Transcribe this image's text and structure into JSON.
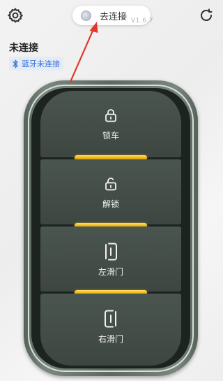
{
  "header": {
    "connect_label": "去连接",
    "version": "V1.6.7"
  },
  "status": {
    "title": "未连接",
    "bluetooth_label": "蓝牙未连接"
  },
  "remote": {
    "buttons": [
      {
        "label": "锁车",
        "icon": "lock-icon"
      },
      {
        "label": "解锁",
        "icon": "unlock-icon"
      },
      {
        "label": "左滑门",
        "icon": "left-sliding-door-icon"
      },
      {
        "label": "右滑门",
        "icon": "right-sliding-door-icon"
      }
    ]
  },
  "colors": {
    "accent_blue": "#2f6fd6",
    "annotation_red": "#e03a2f",
    "remote_body": "#4b5550",
    "divider_gold": "#f1b514"
  }
}
